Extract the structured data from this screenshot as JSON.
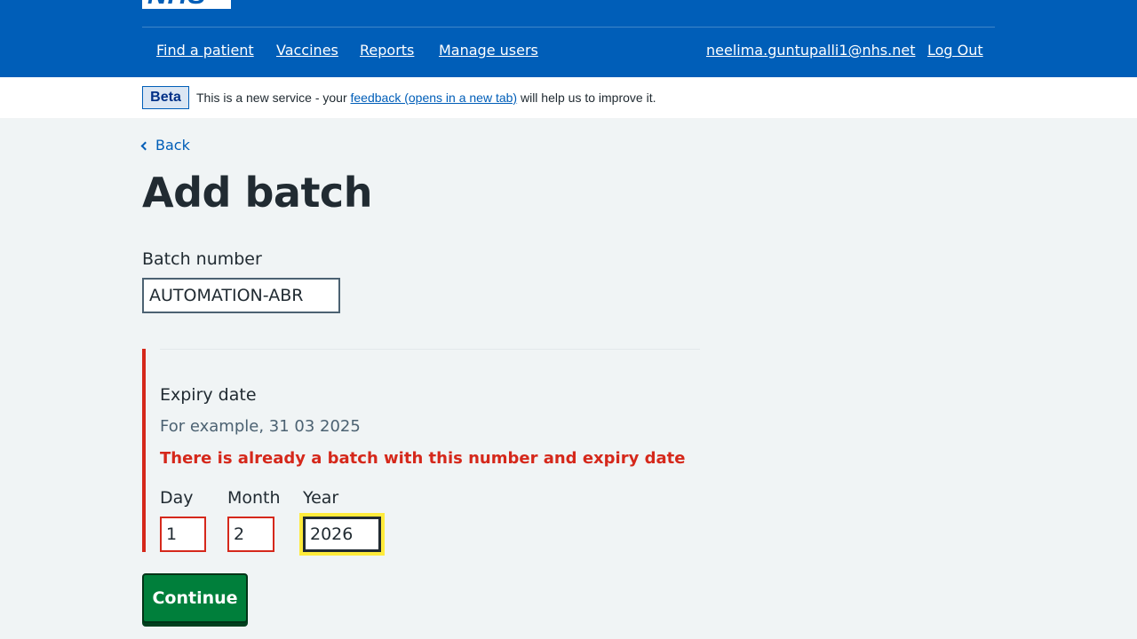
{
  "header": {
    "logo_text": "NHS",
    "brand_color": "#005eb8",
    "nav": {
      "find_patient": "Find a patient",
      "vaccines": "Vaccines",
      "reports": "Reports",
      "manage_users": "Manage users",
      "user_email": "neelima.guntupalli1@nhs.net",
      "log_out": "Log Out"
    }
  },
  "beta": {
    "tag": "Beta",
    "text_before": "This is a new service - your ",
    "link": "feedback (opens in a new tab)",
    "text_after": " will help us to improve it."
  },
  "back": {
    "label": "Back",
    "icon": "chevron-left-icon"
  },
  "page": {
    "title": "Add batch"
  },
  "batch": {
    "label": "Batch number",
    "value": "AUTOMATION-ABR"
  },
  "expiry": {
    "label": "Expiry date",
    "hint": "For example, 31 03 2025",
    "error": "There is already a batch with this number and expiry date",
    "error_color": "#d5281b",
    "day": {
      "label": "Day",
      "value": "1"
    },
    "month": {
      "label": "Month",
      "value": "2"
    },
    "year": {
      "label": "Year",
      "value": "2026"
    }
  },
  "actions": {
    "continue": "Continue",
    "button_color": "#007f3b"
  }
}
